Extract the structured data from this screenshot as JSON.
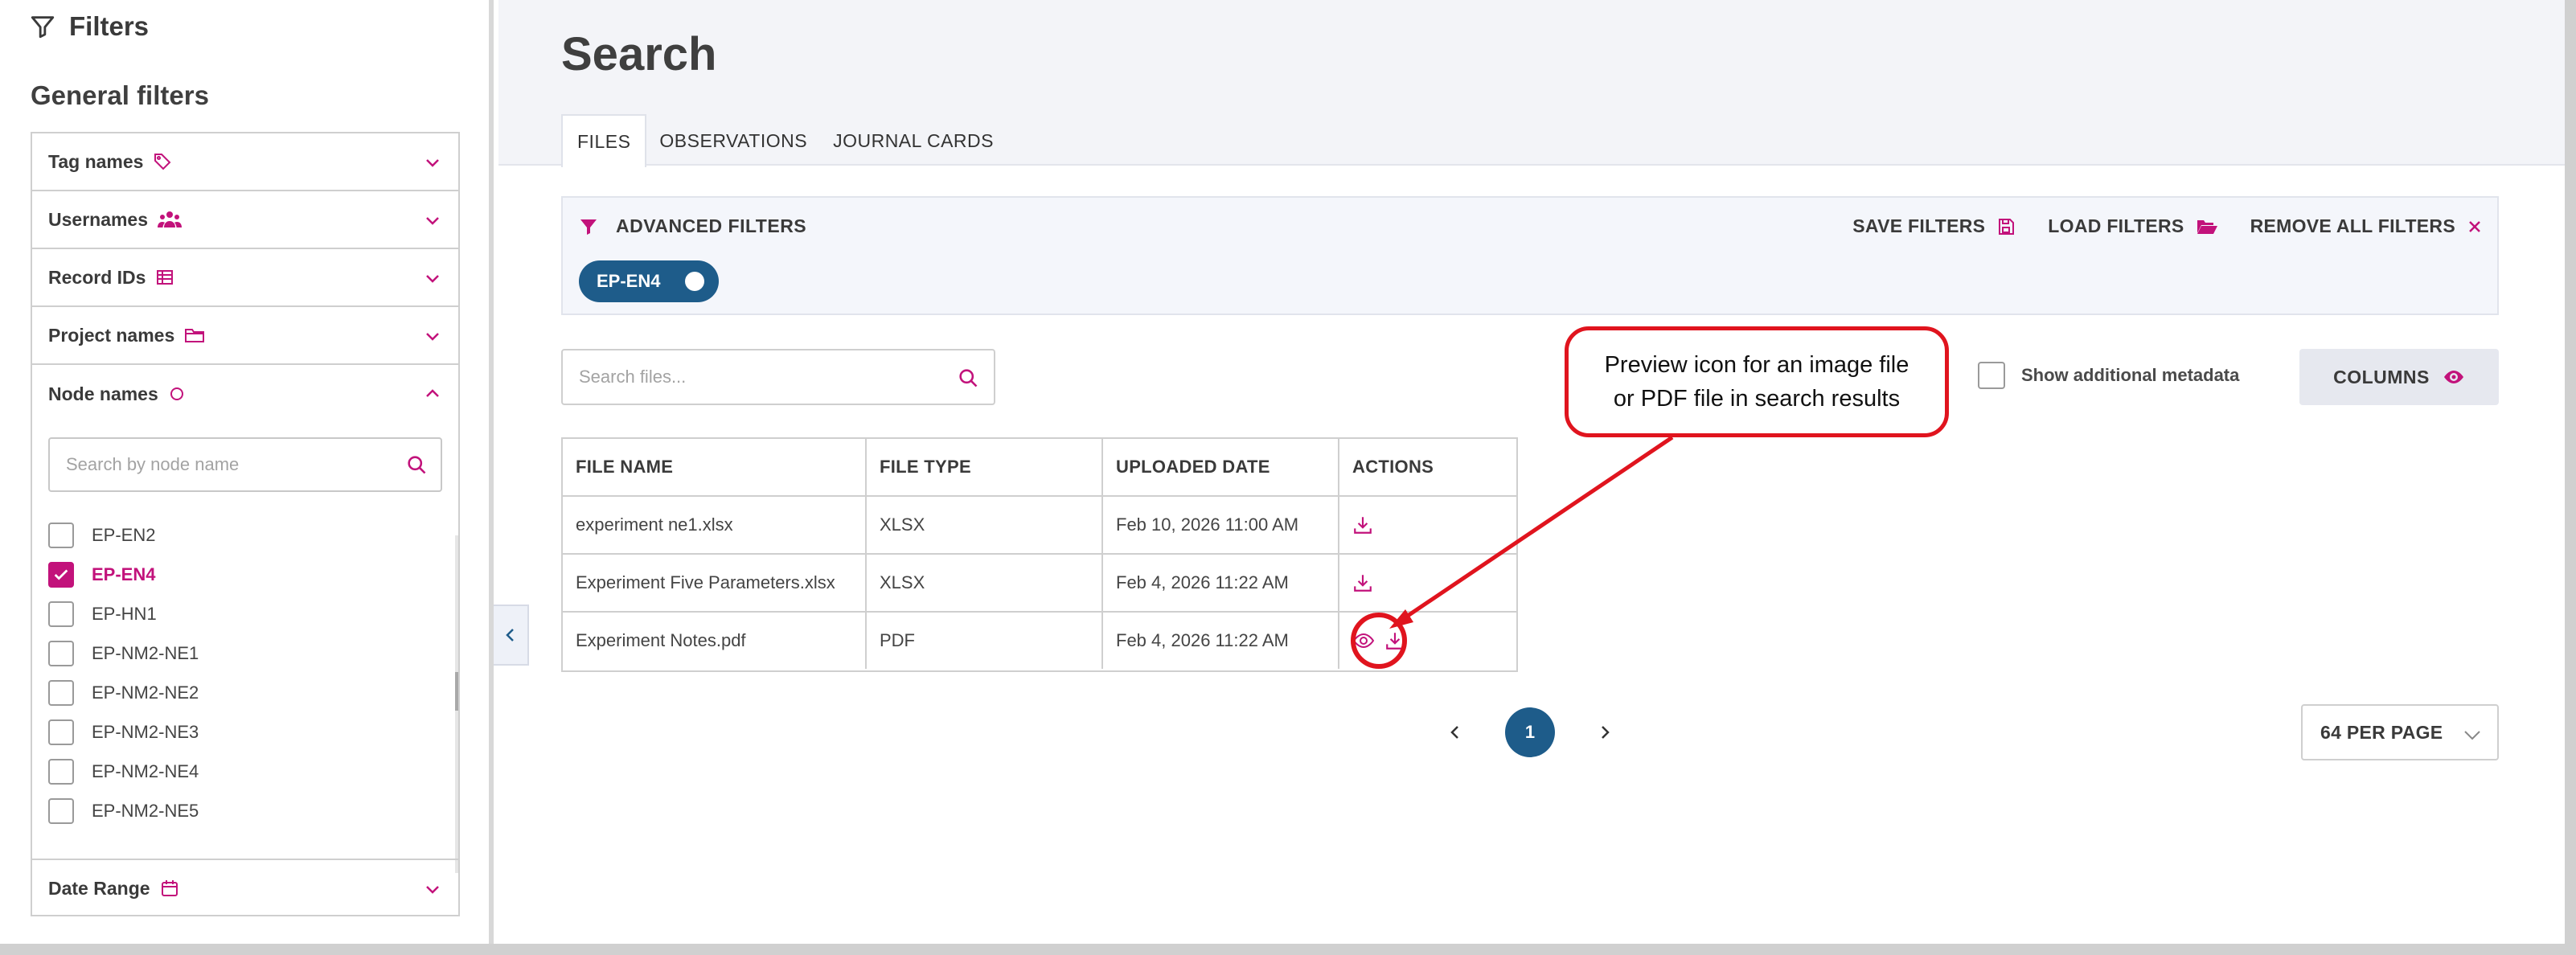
{
  "sidebar": {
    "title": "Filters",
    "subtitle": "General filters",
    "filters": [
      {
        "label": "Tag names",
        "icon": "tag-icon"
      },
      {
        "label": "Usernames",
        "icon": "users-icon"
      },
      {
        "label": "Record IDs",
        "icon": "table-icon"
      },
      {
        "label": "Project names",
        "icon": "folder-icon"
      },
      {
        "label": "Node names",
        "icon": "circle-icon",
        "expanded": true
      },
      {
        "label": "Date Range",
        "icon": "calendar-icon"
      }
    ],
    "node_search_placeholder": "Search by node name",
    "nodes": [
      {
        "label": "EP-EN2",
        "checked": false
      },
      {
        "label": "EP-EN4",
        "checked": true
      },
      {
        "label": "EP-HN1",
        "checked": false
      },
      {
        "label": "EP-NM2-NE1",
        "checked": false
      },
      {
        "label": "EP-NM2-NE2",
        "checked": false
      },
      {
        "label": "EP-NM2-NE3",
        "checked": false
      },
      {
        "label": "EP-NM2-NE4",
        "checked": false
      },
      {
        "label": "EP-NM2-NE5",
        "checked": false
      }
    ]
  },
  "main": {
    "title": "Search",
    "tabs": [
      {
        "label": "FILES",
        "active": true
      },
      {
        "label": "OBSERVATIONS",
        "active": false
      },
      {
        "label": "JOURNAL CARDS",
        "active": false
      }
    ],
    "advanced_filters": {
      "label": "ADVANCED FILTERS",
      "save": "SAVE FILTERS",
      "load": "LOAD FILTERS",
      "remove": "REMOVE ALL FILTERS",
      "chip": "EP-EN4"
    },
    "file_search_placeholder": "Search files...",
    "show_metadata_label": "Show additional metadata",
    "columns_button": "COLUMNS",
    "table": {
      "headers": [
        "FILE NAME",
        "FILE TYPE",
        "UPLOADED DATE",
        "ACTIONS"
      ],
      "rows": [
        {
          "name": "experiment ne1.xlsx",
          "type": "XLSX",
          "date": "Feb 10, 2026 11:00 AM",
          "preview": false
        },
        {
          "name": "Experiment Five Parameters.xlsx",
          "type": "XLSX",
          "date": "Feb 4, 2026 11:22 AM",
          "preview": false
        },
        {
          "name": "Experiment Notes.pdf",
          "type": "PDF",
          "date": "Feb 4, 2026 11:22 AM",
          "preview": true
        }
      ]
    },
    "pagination": {
      "current": "1",
      "per_page": "64 PER PAGE"
    }
  },
  "annotation": {
    "line1": "Preview icon for an image file",
    "line2": "or PDF file in search results"
  },
  "colors": {
    "accent": "#c2127b",
    "primary": "#1e5c8a",
    "callout": "#e0141e"
  }
}
